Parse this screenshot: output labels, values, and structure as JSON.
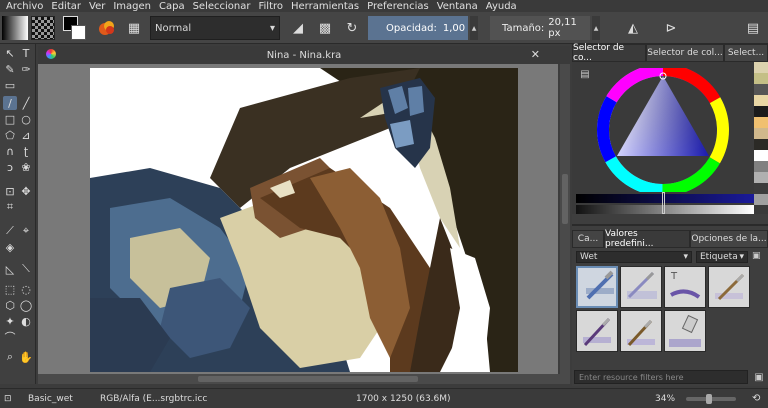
{
  "menu": [
    "Archivo",
    "Editar",
    "Ver",
    "Imagen",
    "Capa",
    "Seleccionar",
    "Filtro",
    "Herramientas",
    "Preferencias",
    "Ventana",
    "Ayuda"
  ],
  "toolbar": {
    "blend_mode": "Normal",
    "opacity_label": "Opacidad:",
    "opacity_value": "1,00",
    "size_label": "Tamaño:",
    "size_value": "20,11 px",
    "opacity_fraction": 1.0
  },
  "document": {
    "tab_title": "Nina - Nina.kra"
  },
  "right_panel": {
    "tabs": [
      "Selector de co...",
      "Selector de col...",
      "Select..."
    ],
    "preset_tabs": [
      "Ca...",
      "Valores predefini...",
      "Opciones de la..."
    ],
    "preset_filter": "Wet",
    "tag_label": "Etiqueta",
    "filter_placeholder": "Enter resource filters here",
    "swatch_colors": [
      "#dcd2ae",
      "#c4bf86",
      "#555555",
      "#e8d6a4",
      "#1b1b1b",
      "#f0c070",
      "#d0b88c",
      "#2b2a26",
      "#ffffff",
      "#808080",
      "#b0b0b0",
      "#3c3c3c",
      "#a0a0a0"
    ]
  },
  "status": {
    "brush": "Basic_wet",
    "color_space": "RGB/Alfa (E...srgbtrc.icc",
    "dimensions": "1700 x 1250 (63.6M)",
    "zoom": "34%"
  }
}
